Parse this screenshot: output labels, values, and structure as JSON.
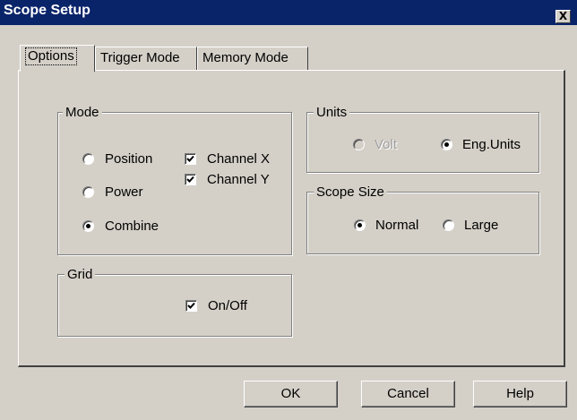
{
  "window": {
    "title": "Scope Setup",
    "close_glyph": "X"
  },
  "tabs": [
    {
      "label": "Options",
      "active": true
    },
    {
      "label": "Trigger Mode",
      "active": false
    },
    {
      "label": "Memory Mode",
      "active": false
    }
  ],
  "mode_group": {
    "legend": "Mode",
    "radios": [
      {
        "label": "Position",
        "checked": false
      },
      {
        "label": "Power",
        "checked": false
      },
      {
        "label": "Combine",
        "checked": true
      }
    ],
    "checkboxes": [
      {
        "label": "Channel X",
        "checked": true
      },
      {
        "label": "Channel Y",
        "checked": true
      }
    ]
  },
  "units_group": {
    "legend": "Units",
    "radios": [
      {
        "label": "Volt",
        "checked": false,
        "disabled": true
      },
      {
        "label": "Eng.Units",
        "checked": true,
        "disabled": false
      }
    ]
  },
  "scope_size_group": {
    "legend": "Scope Size",
    "radios": [
      {
        "label": "Normal",
        "checked": true
      },
      {
        "label": "Large",
        "checked": false
      }
    ]
  },
  "grid_group": {
    "legend": "Grid",
    "checkbox": {
      "label": "On/Off",
      "checked": true
    }
  },
  "buttons": {
    "ok": "OK",
    "cancel": "Cancel",
    "help": "Help"
  },
  "colors": {
    "titlebar": "#0a246a",
    "face": "#d4d0c8",
    "disabled_text": "#a0a0a0"
  }
}
